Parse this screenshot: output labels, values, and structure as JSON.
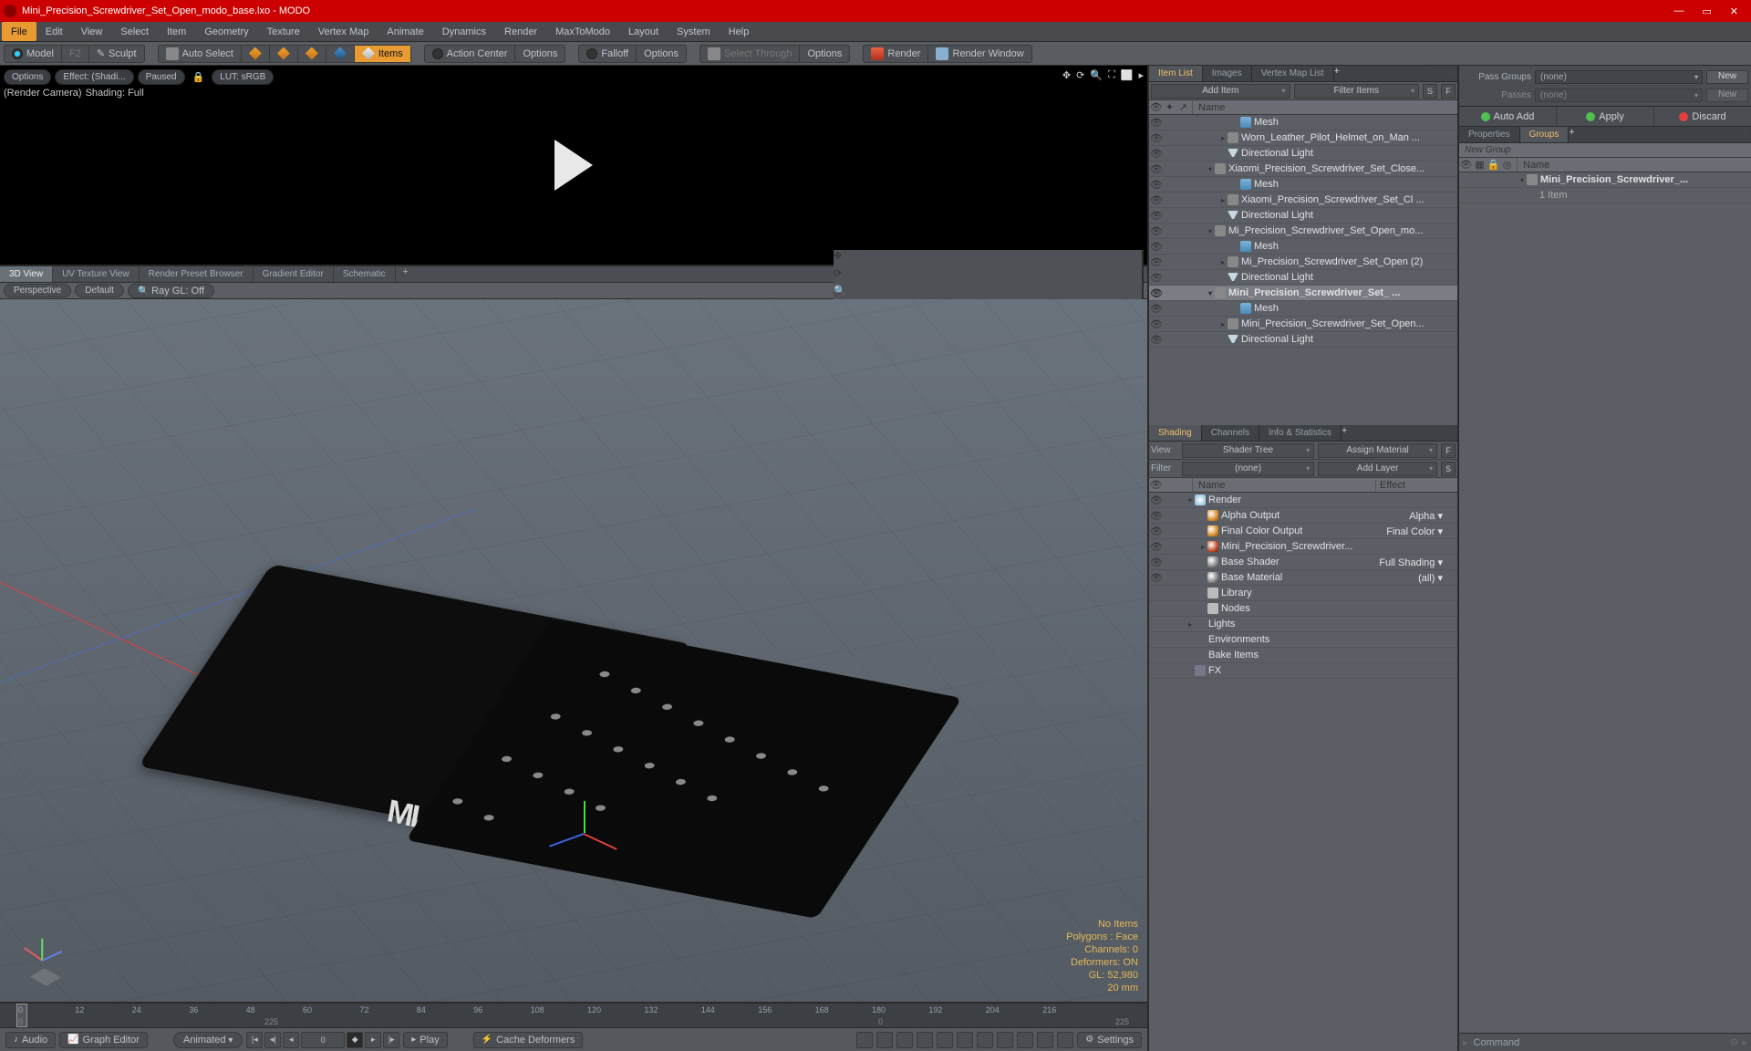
{
  "title": "Mini_Precision_Screwdriver_Set_Open_modo_base.lxo - MODO",
  "menu": [
    "File",
    "Edit",
    "View",
    "Select",
    "Item",
    "Geometry",
    "Texture",
    "Vertex Map",
    "Animate",
    "Dynamics",
    "Render",
    "MaxToModo",
    "Layout",
    "System",
    "Help"
  ],
  "toolbar": {
    "model": "Model",
    "presets": "F2",
    "sculpt": "Sculpt",
    "autoselect": "Auto Select",
    "items": "Items",
    "actioncenter": "Action Center",
    "options1": "Options",
    "falloff": "Falloff",
    "options2": "Options",
    "selectthrough": "Select Through",
    "options3": "Options",
    "render": "Render",
    "renderwindow": "Render Window"
  },
  "renderpreview": {
    "options": "Options",
    "effect": "Effect: (Shadi...",
    "paused": "Paused",
    "lut": "LUT: sRGB",
    "rendercam": "(Render Camera)",
    "shading": "Shading: Full"
  },
  "vptabs": [
    "3D View",
    "UV Texture View",
    "Render Preset Browser",
    "Gradient Editor",
    "Schematic"
  ],
  "vpopts": {
    "perspective": "Perspective",
    "default": "Default",
    "raygl": "Ray GL: Off"
  },
  "stats": {
    "noitems": "No Items",
    "polygons": "Polygons : Face",
    "channels": "Channels: 0",
    "deformers": "Deformers: ON",
    "gl": "GL: 52,980",
    "units": "20 mm"
  },
  "timeline": {
    "ticks": [
      0,
      12,
      24,
      36,
      48,
      60,
      72,
      84,
      96,
      108,
      120,
      132,
      144,
      156,
      168,
      180,
      192,
      204,
      216
    ],
    "startlabel": "0",
    "endlabel": "225",
    "start2": "0",
    "end2": "225"
  },
  "bottombar": {
    "audio": "Audio",
    "graph": "Graph Editor",
    "animated": "Animated",
    "frame": "0",
    "play": "Play",
    "cache": "Cache Deformers",
    "settings": "Settings"
  },
  "itemlist": {
    "tabs": [
      "Item List",
      "Images",
      "Vertex Map List"
    ],
    "additem": "Add Item",
    "filteritems": "Filter Items",
    "namehdr": "Name",
    "rows": [
      {
        "d": 3,
        "t": "mesh",
        "a": "",
        "txt": "Mesh",
        "cls": "ico-mesh"
      },
      {
        "d": 2,
        "t": "item",
        "a": "▸",
        "txt": "Worn_Leather_Pilot_Helmet_on_Man ...",
        "cls": "ico-group"
      },
      {
        "d": 2,
        "t": "light",
        "a": "",
        "txt": "Directional Light",
        "cls": "ico-light"
      },
      {
        "d": 1,
        "t": "group",
        "a": "▾",
        "txt": "Xiaomi_Precision_Screwdriver_Set_Close...",
        "cls": "ico-group"
      },
      {
        "d": 3,
        "t": "mesh",
        "a": "",
        "txt": "Mesh",
        "cls": "ico-mesh"
      },
      {
        "d": 2,
        "t": "item",
        "a": "▸",
        "txt": "Xiaomi_Precision_Screwdriver_Set_Cl ...",
        "cls": "ico-group"
      },
      {
        "d": 2,
        "t": "light",
        "a": "",
        "txt": "Directional Light",
        "cls": "ico-light"
      },
      {
        "d": 1,
        "t": "group",
        "a": "▾",
        "txt": "Mi_Precision_Screwdriver_Set_Open_mo...",
        "cls": "ico-group"
      },
      {
        "d": 3,
        "t": "mesh",
        "a": "",
        "txt": "Mesh",
        "cls": "ico-mesh"
      },
      {
        "d": 2,
        "t": "item",
        "a": "▸",
        "txt": "Mi_Precision_Screwdriver_Set_Open (2)",
        "cls": "ico-group"
      },
      {
        "d": 2,
        "t": "light",
        "a": "",
        "txt": "Directional Light",
        "cls": "ico-light"
      },
      {
        "d": 1,
        "t": "group",
        "a": "▾",
        "txt": "Mini_Precision_Screwdriver_Set_ ...",
        "cls": "ico-group",
        "sel": true
      },
      {
        "d": 3,
        "t": "mesh",
        "a": "",
        "txt": "Mesh",
        "cls": "ico-mesh"
      },
      {
        "d": 2,
        "t": "item",
        "a": "▸",
        "txt": "Mini_Precision_Screwdriver_Set_Open...",
        "cls": "ico-group"
      },
      {
        "d": 2,
        "t": "light",
        "a": "",
        "txt": "Directional Light",
        "cls": "ico-light"
      }
    ]
  },
  "shading": {
    "tabs": [
      "Shading",
      "Channels",
      "Info & Statistics"
    ],
    "view": "View",
    "shadertree": "Shader Tree",
    "assign": "Assign Material",
    "filter": "Filter",
    "none": "(none)",
    "addlayer": "Add Layer",
    "namehdr": "Name",
    "effecthdr": "Effect",
    "rows": [
      {
        "d": 0,
        "a": "▾",
        "txt": "Render",
        "eff": "",
        "cls": "ico-render"
      },
      {
        "d": 1,
        "a": "",
        "txt": "Alpha Output",
        "eff": "Alpha",
        "cls": "ico-mat-o"
      },
      {
        "d": 1,
        "a": "",
        "txt": "Final Color Output",
        "eff": "Final Color",
        "cls": "ico-mat-o"
      },
      {
        "d": 1,
        "a": "▸",
        "txt": "Mini_Precision_Screwdriver...",
        "eff": "",
        "cls": "ico-mat-r"
      },
      {
        "d": 1,
        "a": "",
        "txt": "Base Shader",
        "eff": "Full Shading",
        "cls": "ico-mat"
      },
      {
        "d": 1,
        "a": "",
        "txt": "Base Material",
        "eff": "(all)",
        "cls": "ico-mat"
      },
      {
        "d": 1,
        "a": "",
        "txt": "Library",
        "eff": "",
        "cls": "ico-folder",
        "noeye": true
      },
      {
        "d": 1,
        "a": "",
        "txt": "Nodes",
        "eff": "",
        "cls": "ico-folder",
        "noeye": true
      },
      {
        "d": 0,
        "a": "▸",
        "txt": "Lights",
        "eff": "",
        "cls": "",
        "noeye": true
      },
      {
        "d": 0,
        "a": "",
        "txt": "Environments",
        "eff": "",
        "cls": "",
        "noeye": true
      },
      {
        "d": 0,
        "a": "",
        "txt": "Bake Items",
        "eff": "",
        "cls": "",
        "noeye": true
      },
      {
        "d": 0,
        "a": "",
        "txt": "FX",
        "eff": "",
        "cls": "ico-cam",
        "noeye": true
      }
    ]
  },
  "rightpanel": {
    "passgroups": "Pass Groups",
    "passes": "Passes",
    "none": "(none)",
    "new": "New",
    "autoadd": "Auto Add",
    "apply": "Apply",
    "discard": "Discard",
    "tabs": [
      "Properties",
      "Groups"
    ],
    "newgroup": "New Group",
    "namehdr": "Name",
    "item": "Mini_Precision_Screwdriver_...",
    "count": "1 Item",
    "command": "Command"
  }
}
